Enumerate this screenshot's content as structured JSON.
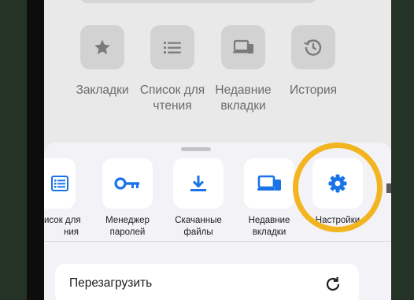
{
  "top_shortcuts": [
    {
      "label": "Закладки",
      "icon": "star-icon"
    },
    {
      "label": "Список для чтения",
      "icon": "reading-list-icon"
    },
    {
      "label": "Недавние вкладки",
      "icon": "recent-tabs-icon"
    },
    {
      "label": "История",
      "icon": "history-icon"
    }
  ],
  "actions": [
    {
      "label": "исок для\nния",
      "icon": "reading-list-icon"
    },
    {
      "label": "Менеджер\nпаролей",
      "icon": "key-icon"
    },
    {
      "label": "Скачанные\nфайлы",
      "icon": "download-icon"
    },
    {
      "label": "Недавние\nвкладки",
      "icon": "devices-icon"
    },
    {
      "label": "Настройки",
      "icon": "gear-icon"
    }
  ],
  "menu_rows": [
    {
      "label": "Перезагрузить",
      "icon": "reload-icon"
    }
  ],
  "colors": {
    "accent": "#1a73e8",
    "highlight": "#f2b51f",
    "sheet_bg": "#f2f2f7",
    "grey_icon": "#7a7a7a"
  }
}
